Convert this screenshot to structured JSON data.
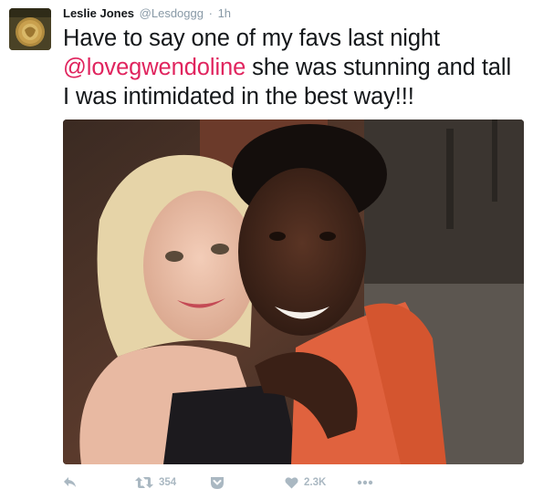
{
  "tweet": {
    "author_name": "Leslie Jones",
    "author_handle": "@Lesdoggg",
    "separator": "·",
    "timestamp": "1h",
    "text_line1": "Have to say one of my favs last night",
    "mention": "@lovegwendoline",
    "text_line2_rest": " she was stunning and tall",
    "text_line3": "I was intimidated in the best way!!!",
    "photo_alt": "Selfie photo"
  },
  "actions": {
    "reply_icon": "reply-arrow-icon",
    "retweet_icon": "retweet-icon",
    "retweet_count": "354",
    "pocket_icon": "pocket-icon",
    "like_icon": "heart-icon",
    "like_count": "2.3K",
    "more_icon": "more-dots-icon"
  },
  "colors": {
    "mention": "#e0245e",
    "muted": "#8899a6",
    "action_icon": "#aab8c2"
  }
}
